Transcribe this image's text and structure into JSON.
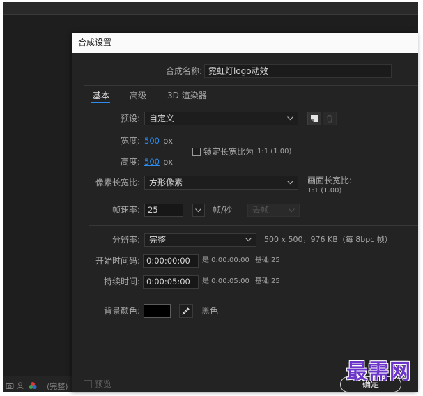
{
  "background": {
    "resolution": "(完整)"
  },
  "dialog": {
    "title": "合成设置",
    "comp_name": {
      "label": "合成名称:",
      "value": "霓虹灯logo动效"
    },
    "tabs": [
      {
        "label": "基本",
        "active": true
      },
      {
        "label": "高级",
        "active": false
      },
      {
        "label": "3D 渲染器",
        "active": false
      }
    ],
    "preset": {
      "label": "预设:",
      "value": "自定义"
    },
    "width": {
      "label": "宽度:",
      "value": "500",
      "unit": "px"
    },
    "height": {
      "label": "高度:",
      "value": "500",
      "unit": "px"
    },
    "lock_aspect": {
      "label": "锁定长宽比为",
      "ratio": "1:1 (1.00)",
      "checked": false
    },
    "pixel_aspect": {
      "label": "像素长宽比:",
      "value": "方形像素"
    },
    "frame_aspect": {
      "label": "画面长宽比:",
      "value": "1:1 (1.00)"
    },
    "frame_rate": {
      "label": "帧速率:",
      "value": "25",
      "unit": "帧/秒",
      "drop_frame": "丢帧"
    },
    "resolution": {
      "label": "分辨率:",
      "value": "完整",
      "info": "500 x 500，976 KB（每 8bpc 帧）"
    },
    "start_timecode": {
      "label": "开始时间码:",
      "value": "0:00:00:00",
      "equals": "是 0:00:00:00",
      "base": "基础 25"
    },
    "duration": {
      "label": "持续时间:",
      "value": "0:00:05:00",
      "equals": "是 0:00:05:00",
      "base": "基础 25"
    },
    "background_color": {
      "label": "背景颜色:",
      "color": "#000000",
      "name": "黑色"
    },
    "preview": {
      "label": "预览",
      "checked": false
    },
    "ok_label": "确定"
  },
  "watermark": "最需网",
  "colors": {
    "accent": "#2d8ceb",
    "dialog_bg": "#232323",
    "titlebar_bg": "#fafafa",
    "watermark": "#6b35c9"
  }
}
